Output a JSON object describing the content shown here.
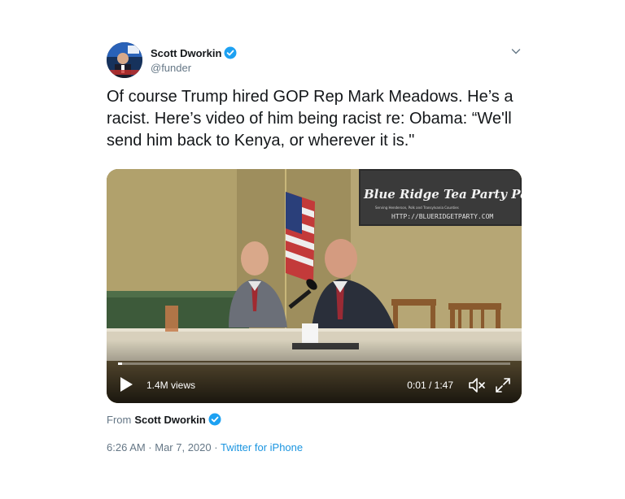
{
  "tweet": {
    "author_name": "Scott Dworkin",
    "handle": "@funder",
    "text": "Of course Trump hired GOP Rep Mark Meadows. He’s a racist. Here’s video of him being racist re: Obama: “We'll send him back to Kenya, or wherever it is.\"",
    "timestamp": "6:26 AM · Mar 7, 2020 · ",
    "source": "Twitter for iPhone"
  },
  "video": {
    "banner_title": "Blue Ridge Tea Party Patr",
    "banner_subtitle": "Serving Henderson, Polk and Transylvania Counties",
    "banner_url": "HTTP://BLUERIDGETPARTY.COM",
    "views": "1.4M views",
    "time": "0:01 / 1:47",
    "progress": 0.01
  },
  "from": {
    "label": "From",
    "name": "Scott Dworkin"
  },
  "colors": {
    "verified": "#1da1f2",
    "link": "#1b95e0",
    "muted_text": "#657786"
  },
  "icons": [
    "verified-icon",
    "chevron-down-icon",
    "play-icon",
    "mute-icon",
    "fullscreen-icon"
  ]
}
